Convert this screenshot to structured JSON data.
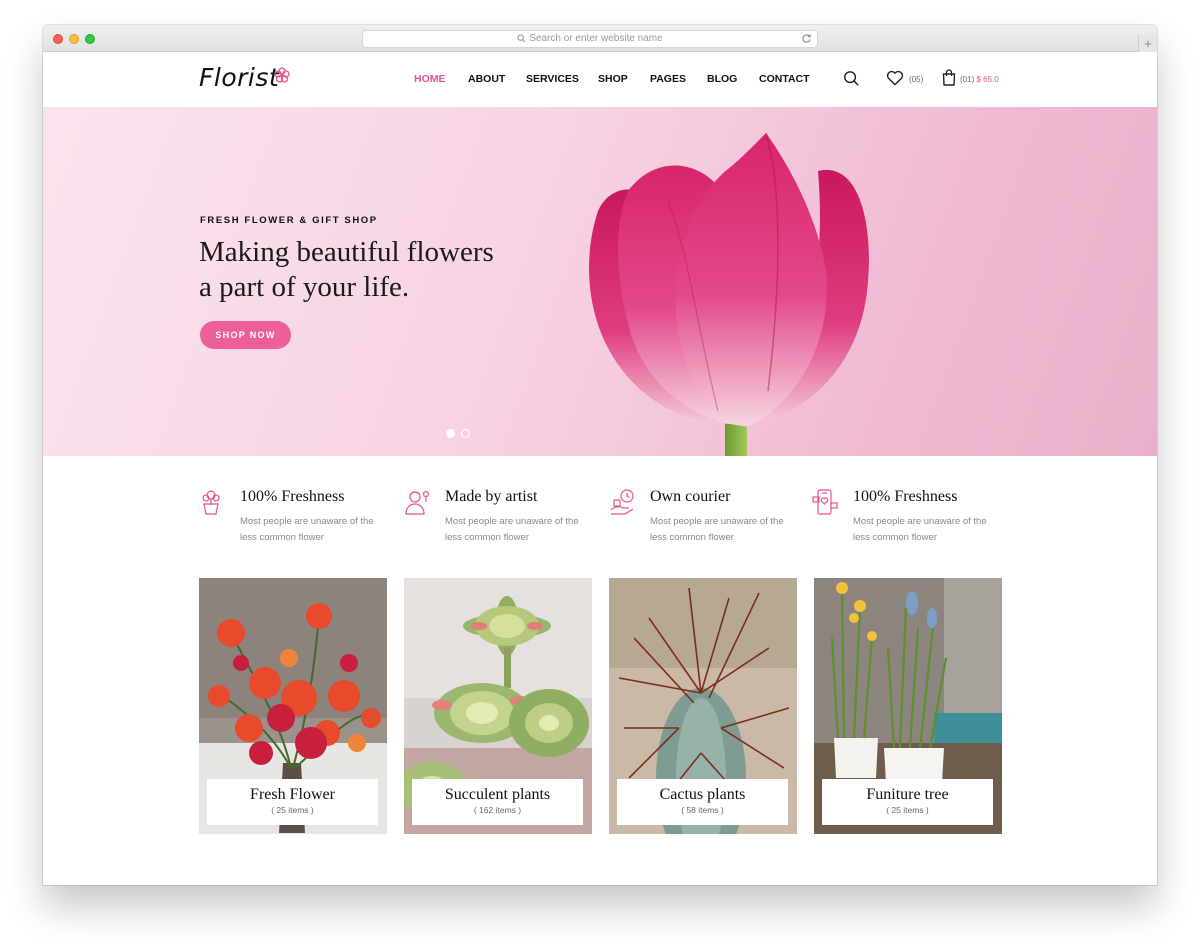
{
  "browser": {
    "address_placeholder": "Search or enter website name",
    "new_tab": "+"
  },
  "header": {
    "logo": "Florist",
    "nav": [
      {
        "label": "HOME",
        "active": true
      },
      {
        "label": "ABOUT",
        "active": false
      },
      {
        "label": "SERVICES",
        "active": false
      },
      {
        "label": "SHOP",
        "active": false
      },
      {
        "label": "PAGES",
        "active": false
      },
      {
        "label": "BLOG",
        "active": false
      },
      {
        "label": "CONTACT",
        "active": false
      }
    ],
    "wishlist_count": "(05)",
    "cart_count": "(01)",
    "cart_total": "$ 65.0",
    "icons": [
      "search-icon",
      "heart-icon",
      "shopping-bag-icon"
    ]
  },
  "hero": {
    "eyebrow": "FRESH FLOWER & GIFT SHOP",
    "headline_line1": "Making beautiful flowers",
    "headline_line2": "a part of your life.",
    "cta": "SHOP NOW",
    "slides_total": 2,
    "slide_active": 1
  },
  "features": [
    {
      "title": "100% Freshness",
      "text": "Most people are unaware of the less common flower",
      "icon": "flower-pot-icon"
    },
    {
      "title": "Made by artist",
      "text": "Most people are unaware of the less common flower",
      "icon": "artist-icon"
    },
    {
      "title": "Own courier",
      "text": "Most people are unaware of the less common flower",
      "icon": "courier-clock-icon"
    },
    {
      "title": "100% Freshness",
      "text": "Most people are unaware of the less common flower",
      "icon": "mobile-order-icon"
    }
  ],
  "categories": [
    {
      "name": "Fresh Flower",
      "count": "( 25 items )"
    },
    {
      "name": "Succulent plants",
      "count": "( 162 items )"
    },
    {
      "name": "Cactus plants",
      "count": "( 58 items )"
    },
    {
      "name": "Funiture tree",
      "count": "( 25 items )"
    }
  ],
  "colors": {
    "accent": "#e8528f",
    "button": "#ec5f98",
    "hero_bg": "#f5cadd"
  }
}
